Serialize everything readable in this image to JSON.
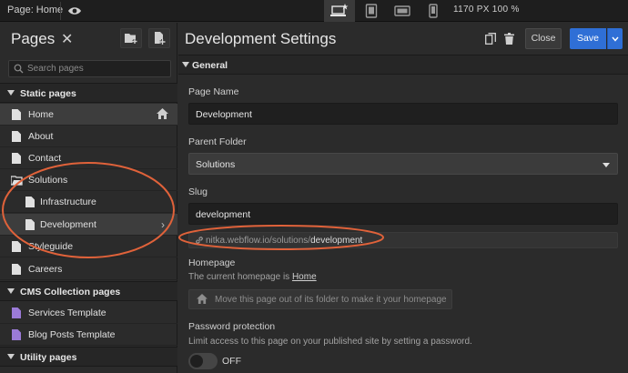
{
  "topbar": {
    "page_label": "Page: Home",
    "icons": [
      "eye-icon",
      "desktop-star-icon",
      "tablet-icon",
      "tablet-landscape-icon",
      "phone-icon"
    ],
    "dimensions": "1170 PX  100 %"
  },
  "sidebar": {
    "title": "Pages",
    "search_placeholder": "Search pages",
    "sections": {
      "static": "Static pages",
      "cms": "CMS Collection pages",
      "utility": "Utility pages"
    },
    "static_pages": [
      {
        "label": "Home"
      },
      {
        "label": "About"
      },
      {
        "label": "Contact"
      },
      {
        "label": "Solutions"
      },
      {
        "label": "Infrastructure"
      },
      {
        "label": "Development"
      },
      {
        "label": "Styleguide"
      },
      {
        "label": "Careers"
      }
    ],
    "cms_pages": [
      {
        "label": "Services Template"
      },
      {
        "label": "Blog Posts Template"
      }
    ]
  },
  "main": {
    "title": "Development Settings",
    "close_label": "Close",
    "save_label": "Save",
    "section_general": "General",
    "page_name_label": "Page Name",
    "page_name_value": "Development",
    "parent_folder_label": "Parent Folder",
    "parent_folder_value": "Solutions",
    "slug_label": "Slug",
    "slug_value": "development",
    "url_prefix": "nitka.webflow.io/solutions/",
    "url_slug": "development",
    "homepage_label": "Homepage",
    "homepage_help_prefix": "The current homepage is ",
    "homepage_help_link": "Home",
    "move_homepage_label": "Move this page out of its folder to make it your homepage",
    "password_label": "Password protection",
    "password_help": "Limit access to this page on your published site by setting a password.",
    "password_toggle_label": "OFF",
    "password_enabled": false
  },
  "colors": {
    "accent": "#2f6fd6",
    "annotation": "#e0623a",
    "cms_icon": "#9b7bd8"
  }
}
